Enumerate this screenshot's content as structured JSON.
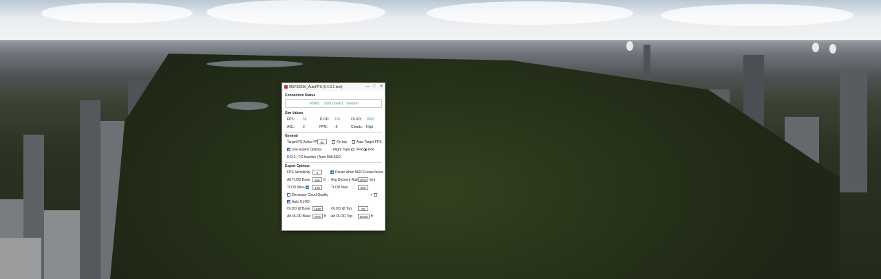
{
  "window": {
    "title": "MSFS2020_AutoFPS (0.4.3.1-test)",
    "minimize_label": "—",
    "maximize_label": "☐",
    "close_label": "✕"
  },
  "connection": {
    "header": "Connection Status",
    "items": [
      "MSFS",
      "SimConnect",
      "Session"
    ]
  },
  "sim_values": {
    "header": "Sim Values",
    "fps_label": "FPS:",
    "fps_value": "56",
    "tlod_label": "TLOD:",
    "tlod_value": "150",
    "olod_label": "OLOD:",
    "olod_value": "1000",
    "agl_label": "AGL:",
    "agl_value": "2",
    "fpm_label": "FPM:",
    "fpm_value": "-6",
    "clouds_label": "Clouds:",
    "clouds_value": "High"
  },
  "general": {
    "header": "General",
    "target_fps_label": "Target FG Active FPS",
    "target_fps_value": "60",
    "on_top_label": "On top",
    "auto_target_label": "Auto Target FPS",
    "use_expert_label": "Use Expert Options",
    "flight_type_label": "Flight Type",
    "vfr_label": "VFR",
    "ifr_label": "IFR",
    "status_line": "DX12 | FG Inactive | Auto PAUSED"
  },
  "expert": {
    "header": "Expert Options",
    "fps_sensitivity_label": "FPS Sensitivity",
    "fps_sensitivity_value": "4",
    "pause_label": "Pause when MSFS loses focus",
    "alt_tlod_base_label": "Alt TLOD Base",
    "alt_tlod_base_value": "250",
    "alt_tlod_base_unit": "ft",
    "avg_descent_label": "Avg Descent Rate",
    "avg_descent_value": "2000",
    "avg_descent_unit": "fpm",
    "tlod_min_label": "TLOD Min",
    "tlod_min_extra": "+",
    "tlod_min_value": "100",
    "tlod_max_label": "TLOD Max",
    "tlod_max_value": "800",
    "decrease_cloud_label": "Decrease Cloud Quality",
    "cloud_extra": "+",
    "auto_olod_label": "Auto OLOD",
    "olod_base_label": "OLOD @ Base",
    "olod_base_value": "1000",
    "olod_top_label": "OLOD @ Top",
    "olod_top_value": "20",
    "alt_olod_base_label": "Alt OLOD Base",
    "alt_olod_base_value": "2000",
    "alt_olod_base_unit": "ft",
    "alt_olod_top_label": "Alt OLOD Top",
    "alt_olod_top_value": "10000",
    "alt_olod_top_unit": "ft"
  },
  "colors": {
    "accent": "#2b6cd4",
    "status_ok": "#2ea44f"
  }
}
